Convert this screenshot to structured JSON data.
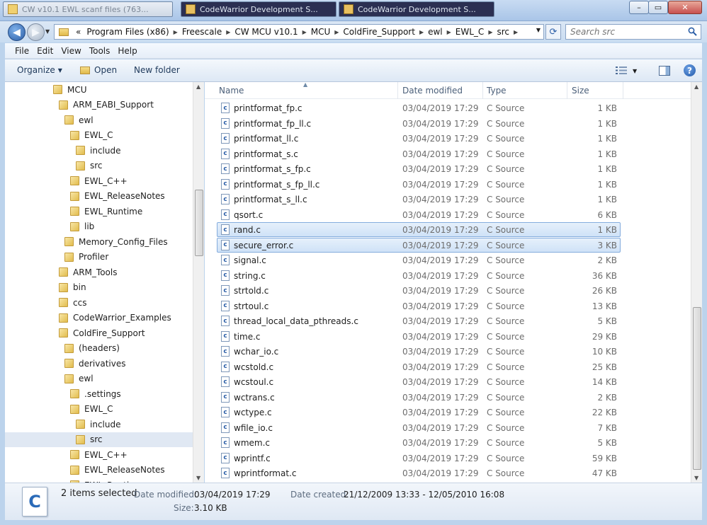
{
  "titlebar": {
    "tabs": [
      "CW v10.1 EWL scanf files (763...",
      "CodeWarrior Development S...",
      "CodeWarrior Development S..."
    ],
    "min": "–",
    "max": "▭",
    "close": "✕"
  },
  "address": {
    "prefix": "«",
    "crumbs": [
      "Program Files (x86)",
      "Freescale",
      "CW MCU v10.1",
      "MCU",
      "ColdFire_Support",
      "ewl",
      "EWL_C",
      "src"
    ],
    "search_placeholder": "Search src"
  },
  "menu": [
    "File",
    "Edit",
    "View",
    "Tools",
    "Help"
  ],
  "commands": {
    "organize": "Organize",
    "open": "Open",
    "new_folder": "New folder"
  },
  "nav": {
    "items": [
      {
        "label": "MCU",
        "indent": 0
      },
      {
        "label": "ARM_EABI_Support",
        "indent": 1
      },
      {
        "label": "ewl",
        "indent": 2
      },
      {
        "label": "EWL_C",
        "indent": 3
      },
      {
        "label": "include",
        "indent": 4
      },
      {
        "label": "src",
        "indent": 4
      },
      {
        "label": "EWL_C++",
        "indent": 3
      },
      {
        "label": "EWL_ReleaseNotes",
        "indent": 3
      },
      {
        "label": "EWL_Runtime",
        "indent": 3
      },
      {
        "label": "lib",
        "indent": 3
      },
      {
        "label": "Memory_Config_Files",
        "indent": 2
      },
      {
        "label": "Profiler",
        "indent": 2
      },
      {
        "label": "ARM_Tools",
        "indent": 1
      },
      {
        "label": "bin",
        "indent": 1
      },
      {
        "label": "ccs",
        "indent": 1
      },
      {
        "label": "CodeWarrior_Examples",
        "indent": 1
      },
      {
        "label": "ColdFire_Support",
        "indent": 1
      },
      {
        "label": "(headers)",
        "indent": 2
      },
      {
        "label": "derivatives",
        "indent": 2
      },
      {
        "label": "ewl",
        "indent": 2
      },
      {
        "label": ".settings",
        "indent": 3
      },
      {
        "label": "EWL_C",
        "indent": 3
      },
      {
        "label": "include",
        "indent": 4
      },
      {
        "label": "src",
        "indent": 4,
        "selected": true
      },
      {
        "label": "EWL_C++",
        "indent": 3
      },
      {
        "label": "EWL_ReleaseNotes",
        "indent": 3
      },
      {
        "label": "EWL_Runtime",
        "indent": 3
      }
    ]
  },
  "columns": {
    "name": "Name",
    "date": "Date modified",
    "type": "Type",
    "size": "Size"
  },
  "files": [
    {
      "name": "printformat_fp.c",
      "date": "03/04/2019 17:29",
      "type": "C Source",
      "size": "1 KB"
    },
    {
      "name": "printformat_fp_ll.c",
      "date": "03/04/2019 17:29",
      "type": "C Source",
      "size": "1 KB"
    },
    {
      "name": "printformat_ll.c",
      "date": "03/04/2019 17:29",
      "type": "C Source",
      "size": "1 KB"
    },
    {
      "name": "printformat_s.c",
      "date": "03/04/2019 17:29",
      "type": "C Source",
      "size": "1 KB"
    },
    {
      "name": "printformat_s_fp.c",
      "date": "03/04/2019 17:29",
      "type": "C Source",
      "size": "1 KB"
    },
    {
      "name": "printformat_s_fp_ll.c",
      "date": "03/04/2019 17:29",
      "type": "C Source",
      "size": "1 KB"
    },
    {
      "name": "printformat_s_ll.c",
      "date": "03/04/2019 17:29",
      "type": "C Source",
      "size": "1 KB"
    },
    {
      "name": "qsort.c",
      "date": "03/04/2019 17:29",
      "type": "C Source",
      "size": "6 KB"
    },
    {
      "name": "rand.c",
      "date": "03/04/2019 17:29",
      "type": "C Source",
      "size": "1 KB",
      "selected": true
    },
    {
      "name": "secure_error.c",
      "date": "03/04/2019 17:29",
      "type": "C Source",
      "size": "3 KB",
      "selected": true
    },
    {
      "name": "signal.c",
      "date": "03/04/2019 17:29",
      "type": "C Source",
      "size": "2 KB"
    },
    {
      "name": "string.c",
      "date": "03/04/2019 17:29",
      "type": "C Source",
      "size": "36 KB"
    },
    {
      "name": "strtold.c",
      "date": "03/04/2019 17:29",
      "type": "C Source",
      "size": "26 KB"
    },
    {
      "name": "strtoul.c",
      "date": "03/04/2019 17:29",
      "type": "C Source",
      "size": "13 KB"
    },
    {
      "name": "thread_local_data_pthreads.c",
      "date": "03/04/2019 17:29",
      "type": "C Source",
      "size": "5 KB"
    },
    {
      "name": "time.c",
      "date": "03/04/2019 17:29",
      "type": "C Source",
      "size": "29 KB"
    },
    {
      "name": "wchar_io.c",
      "date": "03/04/2019 17:29",
      "type": "C Source",
      "size": "10 KB"
    },
    {
      "name": "wcstold.c",
      "date": "03/04/2019 17:29",
      "type": "C Source",
      "size": "25 KB"
    },
    {
      "name": "wcstoul.c",
      "date": "03/04/2019 17:29",
      "type": "C Source",
      "size": "14 KB"
    },
    {
      "name": "wctrans.c",
      "date": "03/04/2019 17:29",
      "type": "C Source",
      "size": "2 KB"
    },
    {
      "name": "wctype.c",
      "date": "03/04/2019 17:29",
      "type": "C Source",
      "size": "22 KB"
    },
    {
      "name": "wfile_io.c",
      "date": "03/04/2019 17:29",
      "type": "C Source",
      "size": "7 KB"
    },
    {
      "name": "wmem.c",
      "date": "03/04/2019 17:29",
      "type": "C Source",
      "size": "5 KB"
    },
    {
      "name": "wprintf.c",
      "date": "03/04/2019 17:29",
      "type": "C Source",
      "size": "59 KB"
    },
    {
      "name": "wprintformat.c",
      "date": "03/04/2019 17:29",
      "type": "C Source",
      "size": "47 KB"
    }
  ],
  "details": {
    "icon_letter": "C",
    "selection": "2 items selected",
    "date_modified_label": "Date modified:",
    "date_modified": "03/04/2019 17:29",
    "date_created_label": "Date created:",
    "date_created": "21/12/2009 13:33 - 12/05/2010 16:08",
    "size_label": "Size:",
    "size": "3.10 KB"
  },
  "colors": {
    "selection_fill": "#cfe2f7",
    "selection_border": "#84acdd",
    "accent": "#1e395b"
  }
}
